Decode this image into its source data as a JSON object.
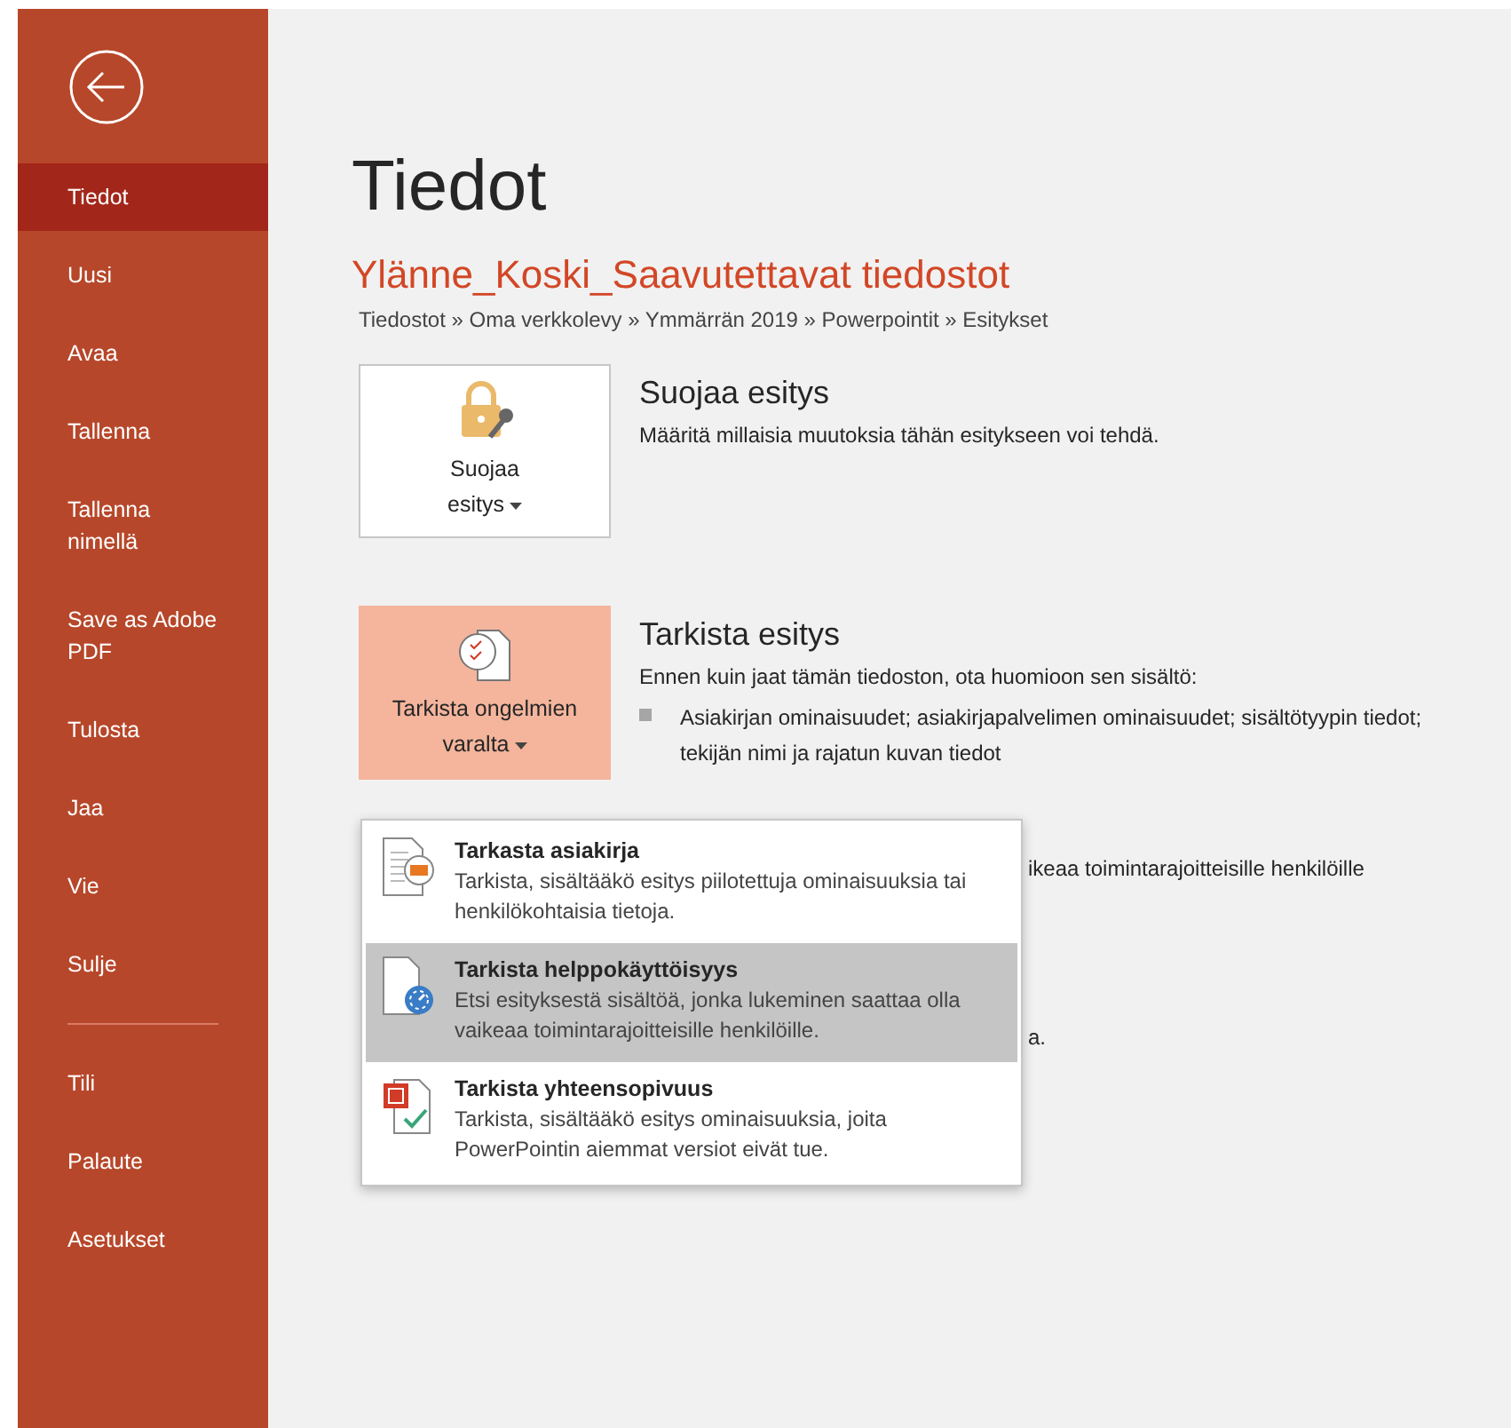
{
  "sidebar": {
    "items": [
      {
        "label": "Tiedot",
        "selected": true
      },
      {
        "label": "Uusi",
        "selected": false
      },
      {
        "label": "Avaa",
        "selected": false
      },
      {
        "label": "Tallenna",
        "selected": false
      },
      {
        "label": "Tallenna nimellä",
        "selected": false
      },
      {
        "label": "Save as Adobe PDF",
        "selected": false
      },
      {
        "label": "Tulosta",
        "selected": false
      },
      {
        "label": "Jaa",
        "selected": false
      },
      {
        "label": "Vie",
        "selected": false
      },
      {
        "label": "Sulje",
        "selected": false
      }
    ],
    "bottom_items": [
      {
        "label": "Tili",
        "selected": false
      },
      {
        "label": "Palaute",
        "selected": false
      },
      {
        "label": "Asetukset",
        "selected": false
      }
    ]
  },
  "page_title": "Tiedot",
  "file_name": "Ylänne_Koski_Saavutettavat tiedostot",
  "breadcrumb": "Tiedostot » Oma verkkolevy » Ymmärrän 2019 » Powerpointit » Esitykset",
  "sections": [
    {
      "kind": "protect",
      "button_label": "Suojaa esitys",
      "active": false,
      "heading": "Suojaa esitys",
      "description": "Määritä millaisia muutoksia tähän esitykseen voi tehdä."
    },
    {
      "kind": "inspect",
      "button_label": "Tarkista ongelmien varalta",
      "active": true,
      "heading": "Tarkista esitys",
      "description": "Ennen kuin jaat tämän tiedoston, ota huomioon sen sisältö:",
      "bullets": [
        "Asiakirjan ominaisuudet; asiakirjapalvelimen ominaisuudet; sisältötyypin tiedot; tekijän nimi ja rajatun kuvan tiedot"
      ],
      "partly_hidden": [
        "ikeaa toimintarajoitteisille henkilöille",
        "a."
      ]
    }
  ],
  "menu": {
    "items": [
      {
        "kind": "inspect",
        "title": "Tarkasta asiakirja",
        "description": "Tarkista, sisältääkö esitys piilotettuja ominaisuuksia tai henkilökohtaisia tietoja.",
        "selected": false
      },
      {
        "kind": "accessibility",
        "title": "Tarkista helppokäyttöisyys",
        "description": "Etsi esityksestä sisältöä, jonka lukeminen saattaa olla vaikeaa toimintarajoitteisille henkilöille.",
        "selected": true
      },
      {
        "kind": "compatibility",
        "title": "Tarkista yhteensopivuus",
        "description": "Tarkista, sisältääkö esitys ominaisuuksia, joita PowerPointin aiemmat versiot eivät tue.",
        "selected": false
      }
    ]
  }
}
